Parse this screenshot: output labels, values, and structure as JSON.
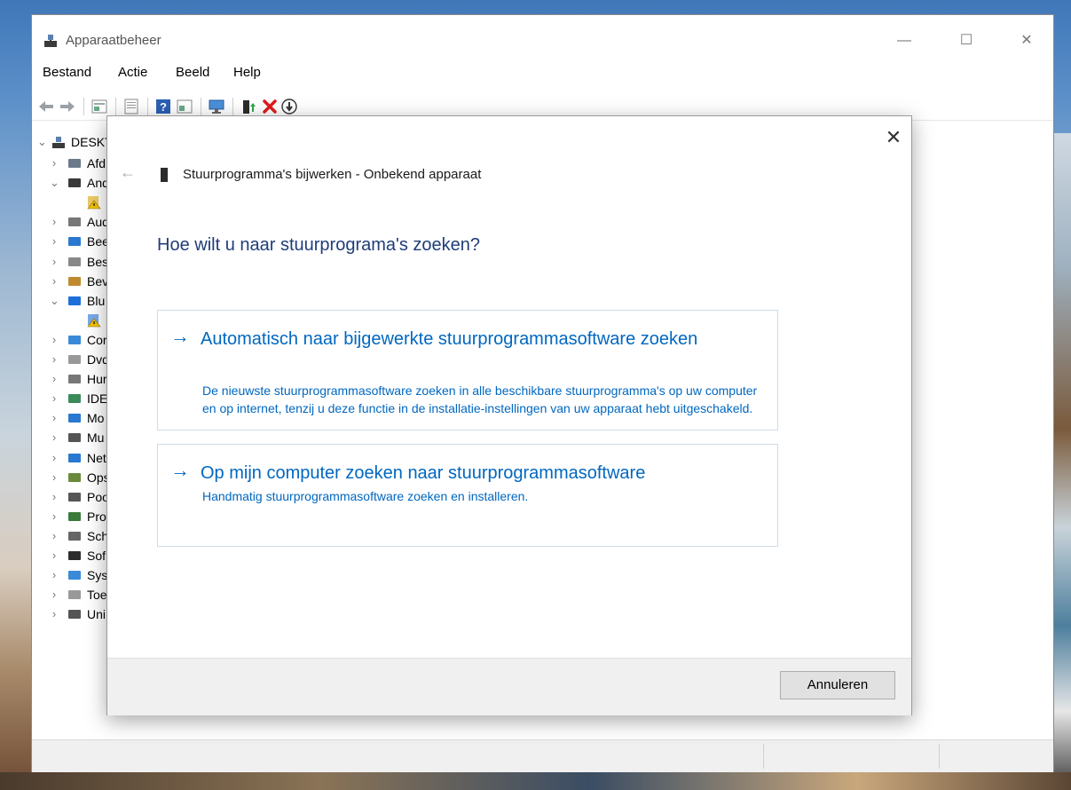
{
  "window": {
    "title": "Apparaatbeheer",
    "controls": {
      "minimize": "—",
      "maximize": "☐",
      "close": "✕"
    }
  },
  "menubar": [
    "Bestand",
    "Actie",
    "Beeld",
    "Help"
  ],
  "toolbar": {
    "icons": [
      "back-icon",
      "forward-icon",
      "properties-icon",
      "view-icon",
      "help-icon",
      "details-icon",
      "computer-icon",
      "update-driver-icon",
      "uninstall-icon",
      "download-icon"
    ]
  },
  "tree": {
    "root": "DESKTC",
    "items": [
      {
        "label": "Afd",
        "icon": "printer-queue-icon",
        "expanded": false
      },
      {
        "label": "And",
        "icon": "other-devices-icon",
        "expanded": true
      },
      {
        "label": "",
        "icon": "unknown-device-warning-icon",
        "child": true
      },
      {
        "label": "Aud",
        "icon": "audio-icon",
        "expanded": false
      },
      {
        "label": "Bee",
        "icon": "monitor-icon",
        "expanded": false
      },
      {
        "label": "Bes",
        "icon": "sound-icon",
        "expanded": false
      },
      {
        "label": "Bev",
        "icon": "security-icon",
        "expanded": false
      },
      {
        "label": "Blu",
        "icon": "bluetooth-icon",
        "expanded": true
      },
      {
        "label": "",
        "icon": "bluetooth-warning-icon",
        "child": true
      },
      {
        "label": "Cor",
        "icon": "computer-icon",
        "expanded": false
      },
      {
        "label": "Dvd",
        "icon": "dvd-icon",
        "expanded": false
      },
      {
        "label": "Hur",
        "icon": "hid-icon",
        "expanded": false
      },
      {
        "label": "IDE",
        "icon": "ide-icon",
        "expanded": false
      },
      {
        "label": "Mo",
        "icon": "monitor-icon",
        "expanded": false
      },
      {
        "label": "Mu",
        "icon": "mouse-icon",
        "expanded": false
      },
      {
        "label": "Net",
        "icon": "network-icon",
        "expanded": false
      },
      {
        "label": "Ops",
        "icon": "storage-icon",
        "expanded": false
      },
      {
        "label": "Poo",
        "icon": "ports-icon",
        "expanded": false
      },
      {
        "label": "Pro",
        "icon": "processor-icon",
        "expanded": false
      },
      {
        "label": "Sch",
        "icon": "disk-icon",
        "expanded": false
      },
      {
        "label": "Sof",
        "icon": "software-icon",
        "expanded": false
      },
      {
        "label": "Sys",
        "icon": "system-icon",
        "expanded": false
      },
      {
        "label": "Toe",
        "icon": "keyboard-icon",
        "expanded": false
      },
      {
        "label": "Uni",
        "icon": "usb-icon",
        "expanded": false
      }
    ]
  },
  "dialog": {
    "close": "✕",
    "back": "←",
    "title": "Stuurprogramma's bijwerken - Onbekend apparaat",
    "question": "Hoe wilt u naar stuurprograma's zoeken?",
    "options": [
      {
        "arrow": "→",
        "title": "Automatisch naar bijgewerkte stuurprogrammasoftware zoeken",
        "description": " De nieuwste stuurprogrammasoftware zoeken in alle beschikbare stuurprogramma's op uw computer en op internet, tenzij u deze functie in de installatie-instellingen van uw apparaat hebt uitgeschakeld."
      },
      {
        "arrow": "→",
        "title": "Op mijn computer zoeken naar stuurprogrammasoftware",
        "description": "Handmatig stuurprogrammasoftware zoeken en installeren."
      }
    ],
    "cancel_label": "Annuleren"
  },
  "colors": {
    "link": "#0067c0",
    "heading": "#1f3d7a",
    "footer": "#f0f0f0"
  }
}
